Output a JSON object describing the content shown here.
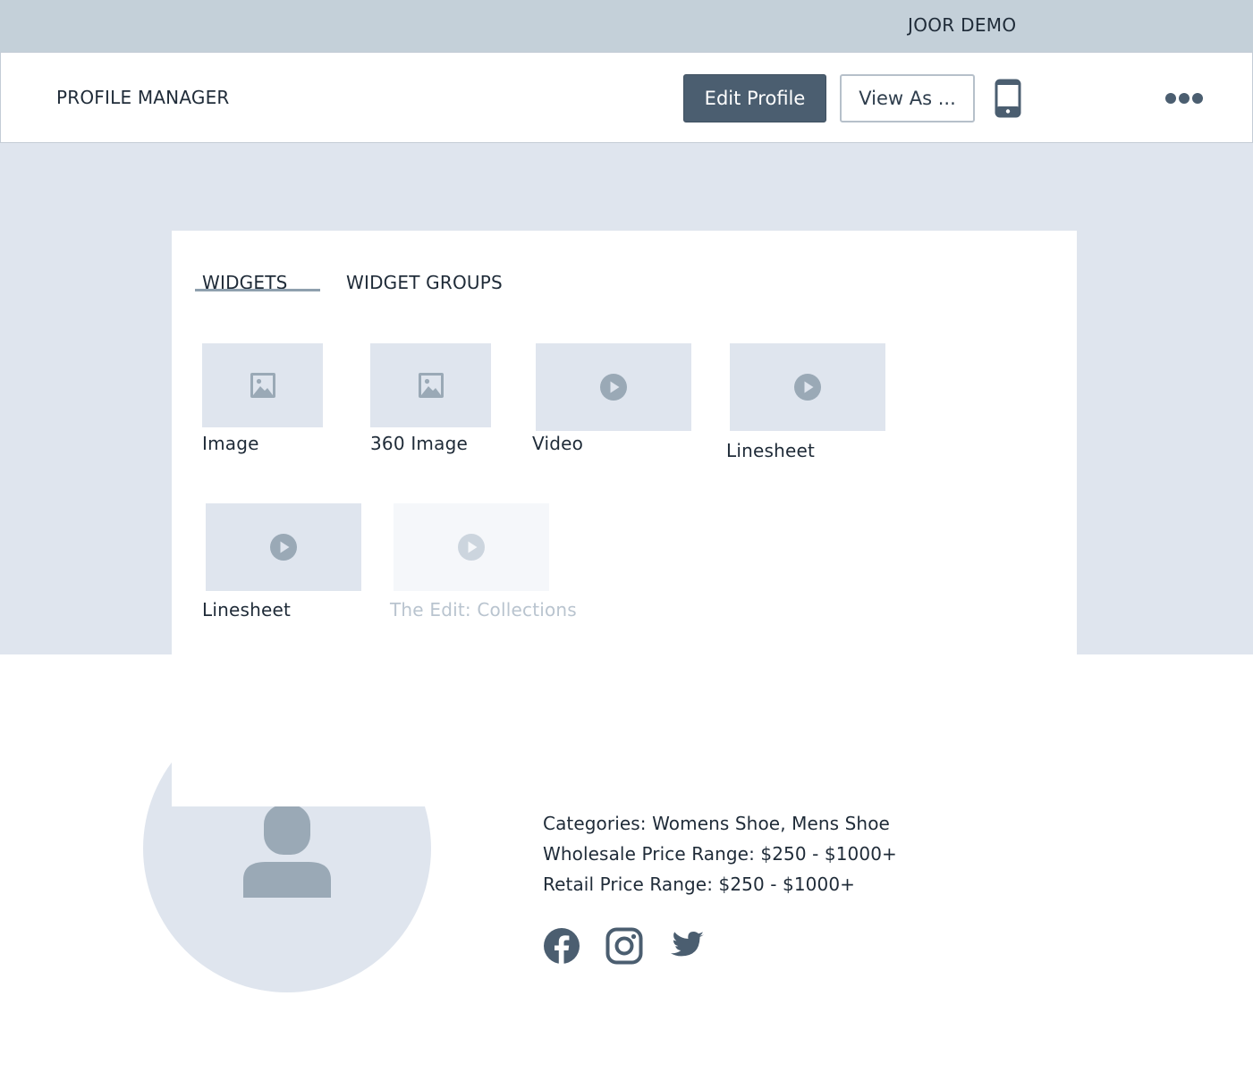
{
  "account": {
    "name": "JOOR DEMO"
  },
  "header": {
    "title": "PROFILE MANAGER",
    "edit_profile_label": "Edit Profile",
    "view_as_label": "View As ..."
  },
  "tabs": [
    {
      "label": "WIDGETS",
      "active": true
    },
    {
      "label": "WIDGET GROUPS",
      "active": false
    }
  ],
  "widgets": [
    {
      "label": "Image",
      "icon": "image-icon",
      "enabled": true
    },
    {
      "label": "360 Image",
      "icon": "image-icon",
      "enabled": true
    },
    {
      "label": "Video",
      "icon": "play-icon",
      "enabled": true
    },
    {
      "label": "Linesheet",
      "icon": "play-icon",
      "enabled": true
    },
    {
      "label": "Linesheet",
      "icon": "play-icon",
      "enabled": true
    },
    {
      "label": "The Edit: Collections",
      "icon": "play-icon",
      "enabled": false
    }
  ],
  "profile": {
    "categories": "Categories: Womens Shoe, Mens Shoe",
    "wholesale": "Wholesale Price Range: $250 - $1000+",
    "retail": "Retail Price Range: $250 - $1000+",
    "social": [
      "facebook-icon",
      "instagram-icon",
      "twitter-icon"
    ]
  },
  "colors": {
    "primary_button": "#4b5e70",
    "placeholder_fill": "#dfe5ee",
    "icon_gray": "#9aa9b6",
    "dark_icon": "#4b5e70"
  }
}
